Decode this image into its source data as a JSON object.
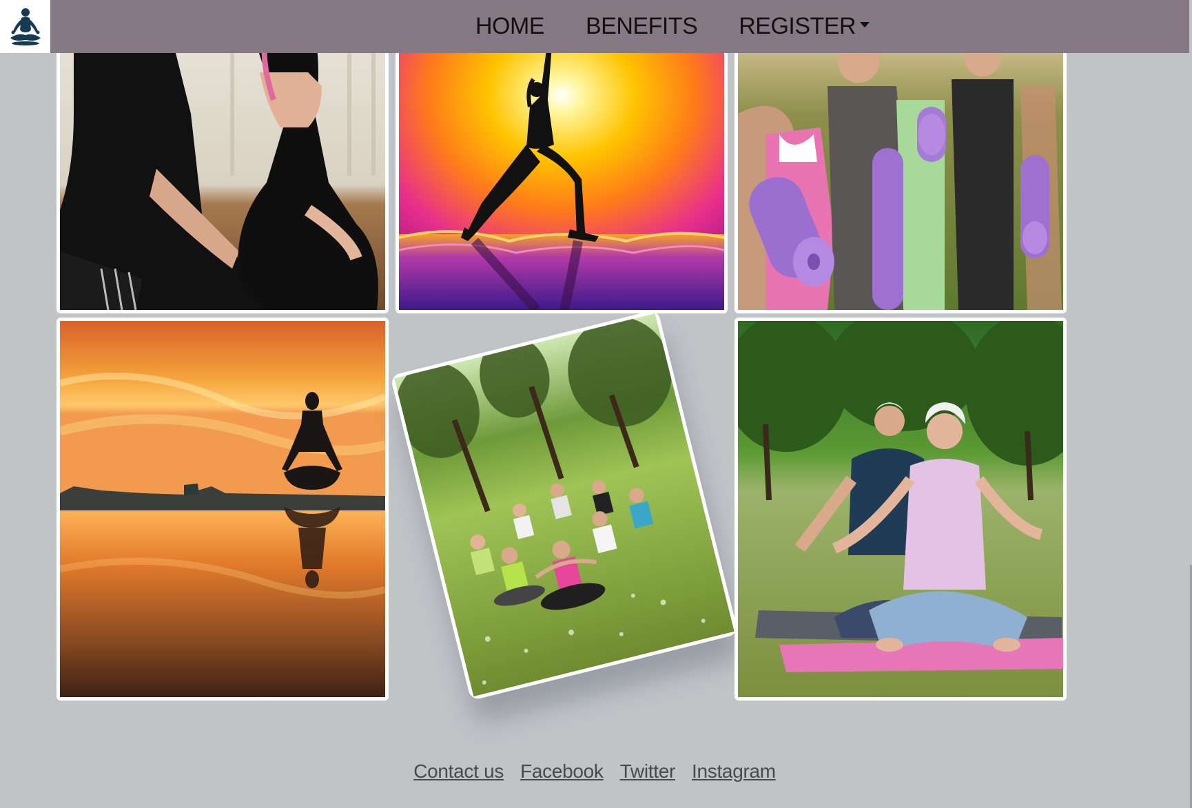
{
  "nav": {
    "items": [
      {
        "label": "HOME"
      },
      {
        "label": "BENEFITS"
      },
      {
        "label": "REGISTER"
      }
    ],
    "logo_icon": "meditation-figure-icon",
    "colors": {
      "bar": "#857a83",
      "logo_bg": "#ffffff",
      "logo_figure": "#163a52"
    }
  },
  "gallery": {
    "images": [
      {
        "name": "kneeling-couple-photo"
      },
      {
        "name": "sunset-warrior-pose-photo"
      },
      {
        "name": "women-with-yoga-mats-photo"
      },
      {
        "name": "lake-sunset-meditation-photo"
      },
      {
        "name": "park-group-meditation-photo"
      },
      {
        "name": "seniors-meditating-park-photo"
      }
    ]
  },
  "footer": {
    "links": [
      {
        "label": "Contact us"
      },
      {
        "label": "Facebook"
      },
      {
        "label": "Twitter"
      },
      {
        "label": "Instagram"
      }
    ]
  },
  "page": {
    "background": "#c1c4c7"
  }
}
